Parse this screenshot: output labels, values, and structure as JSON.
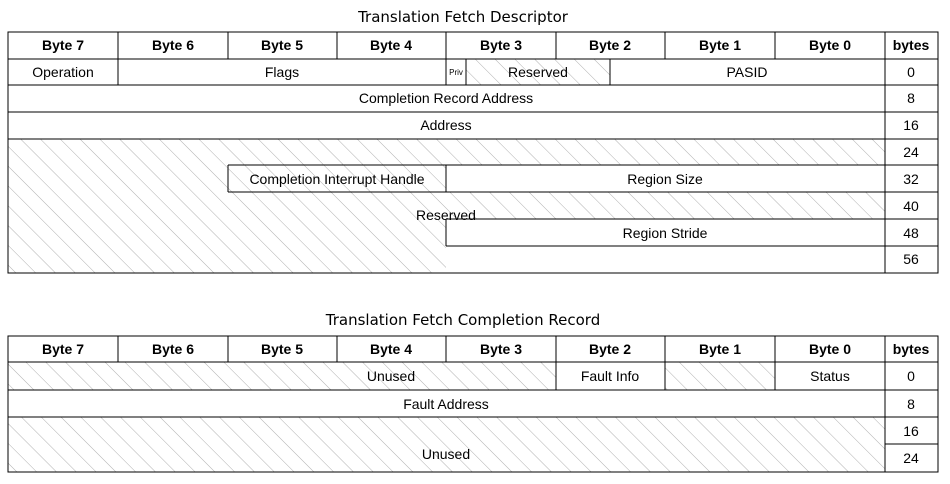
{
  "descriptor": {
    "title": "Translation Fetch Descriptor",
    "headers": [
      "Byte 7",
      "Byte 6",
      "Byte 5",
      "Byte 4",
      "Byte 3",
      "Byte 2",
      "Byte 1",
      "Byte 0",
      "bytes"
    ],
    "fields": {
      "operation": "Operation",
      "flags": "Flags",
      "priv": "Priv",
      "reserved_row0": "Reserved",
      "pasid": "PASID",
      "completion_record_address": "Completion Record Address",
      "address": "Address",
      "completion_interrupt_handle": "Completion Interrupt Handle",
      "region_size": "Region Size",
      "reserved_big": "Reserved",
      "region_stride": "Region Stride"
    },
    "offsets": [
      "0",
      "8",
      "16",
      "24",
      "32",
      "40",
      "48",
      "56"
    ]
  },
  "completion": {
    "title": "Translation Fetch Completion Record",
    "headers": [
      "Byte 7",
      "Byte 6",
      "Byte 5",
      "Byte 4",
      "Byte 3",
      "Byte 2",
      "Byte 1",
      "Byte 0",
      "bytes"
    ],
    "fields": {
      "unused_row0": "Unused",
      "fault_info": "Fault Info",
      "status": "Status",
      "fault_address": "Fault Address",
      "unused_big": "Unused"
    },
    "offsets": [
      "0",
      "8",
      "16",
      "24"
    ]
  },
  "colors": {
    "line": "#000000",
    "hatch": "#b0b0b0",
    "background": "#ffffff"
  }
}
